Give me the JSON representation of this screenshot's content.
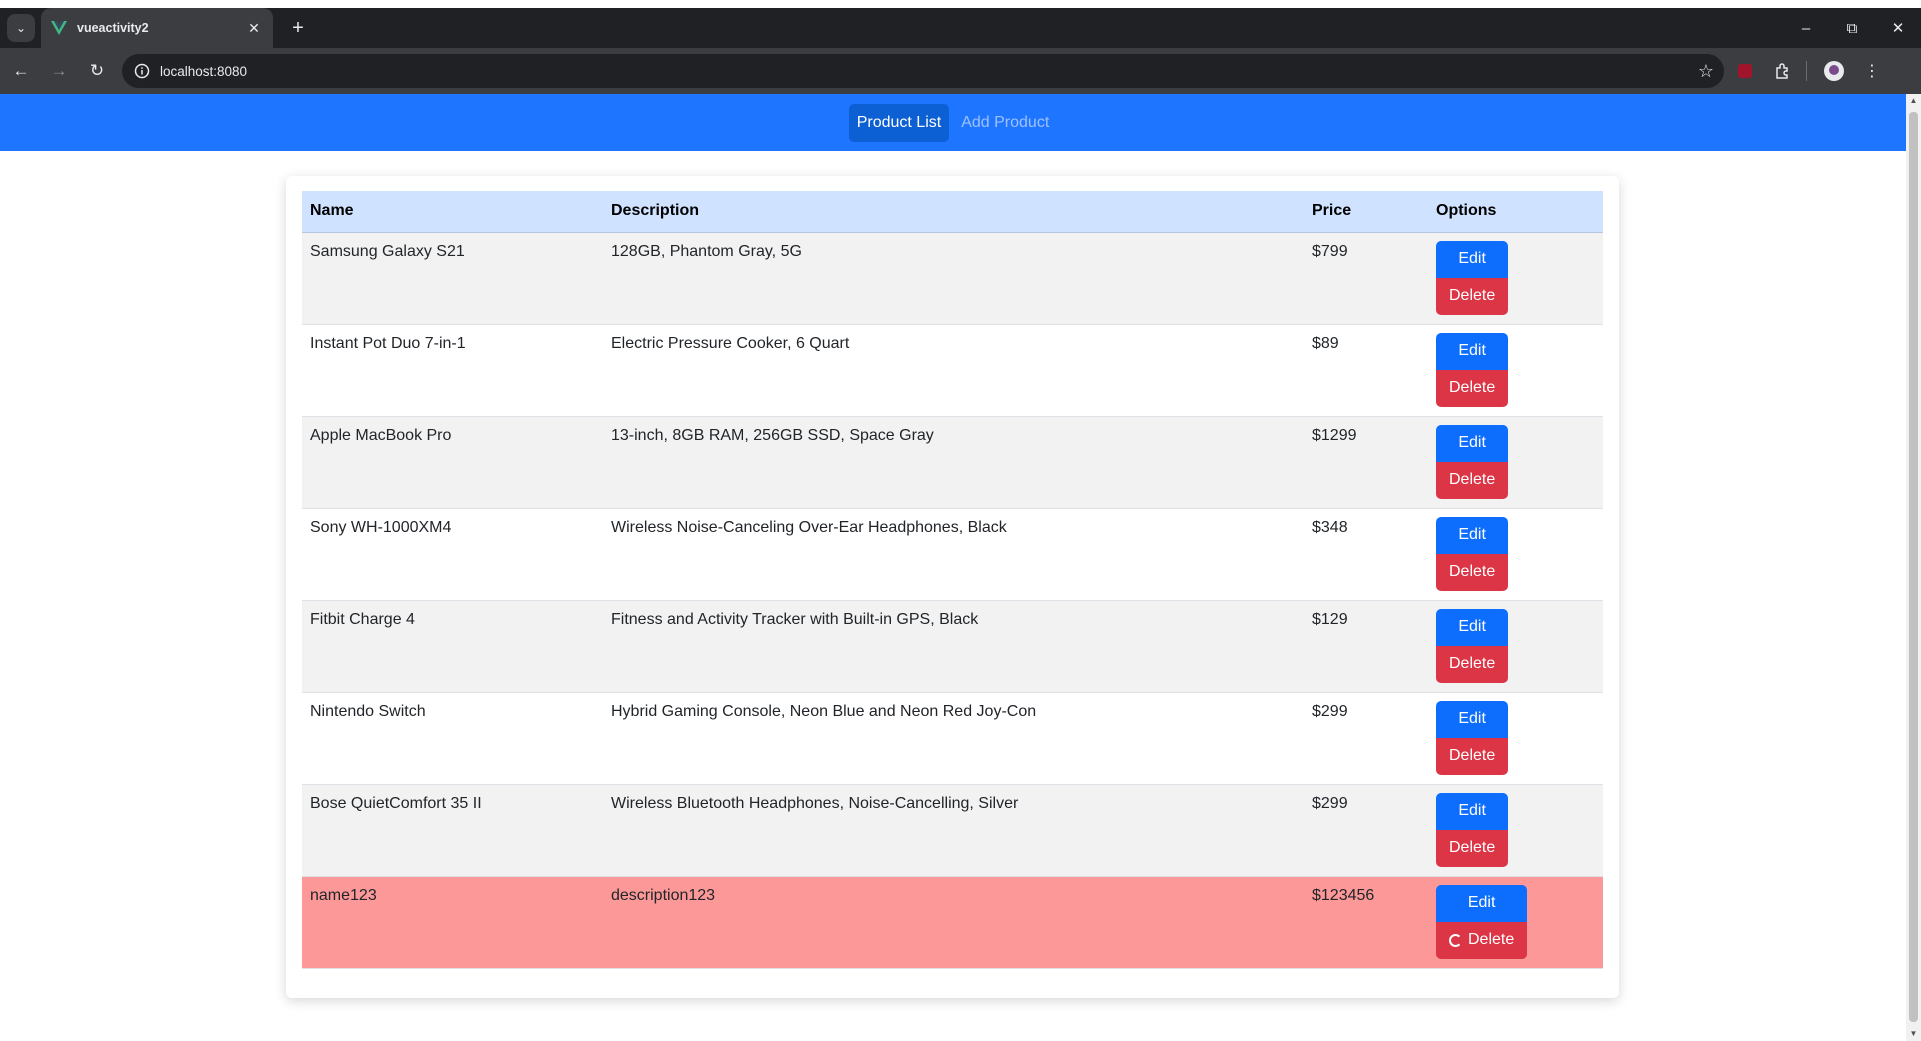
{
  "browser": {
    "tab_title": "vueactivity2",
    "url": "localhost:8080",
    "icons": [
      "tab-list-icon",
      "vue-logo-icon",
      "close-icon",
      "new-tab-icon",
      "minimize-icon",
      "restore-icon",
      "close-window-icon",
      "back-icon",
      "forward-icon",
      "reload-icon",
      "site-info-icon",
      "bookmark-star-icon",
      "ublock-extension-icon",
      "extensions-icon",
      "profile-avatar-icon",
      "menu-kebab-icon"
    ]
  },
  "navbar": {
    "links": [
      {
        "label": "Product List",
        "active": true
      },
      {
        "label": "Add Product",
        "active": false
      }
    ]
  },
  "table": {
    "headers": [
      "Name",
      "Description",
      "Price",
      "Options"
    ],
    "rows": [
      {
        "name": "Samsung Galaxy S21",
        "description": "128GB, Phantom Gray, 5G",
        "price": "$799",
        "edit": "Edit",
        "delete": "Delete"
      },
      {
        "name": "Instant Pot Duo 7-in-1",
        "description": "Electric Pressure Cooker, 6 Quart",
        "price": "$89",
        "edit": "Edit",
        "delete": "Delete"
      },
      {
        "name": "Apple MacBook Pro",
        "description": "13-inch, 8GB RAM, 256GB SSD, Space Gray",
        "price": "$1299",
        "edit": "Edit",
        "delete": "Delete"
      },
      {
        "name": "Sony WH-1000XM4",
        "description": "Wireless Noise-Canceling Over-Ear Headphones, Black",
        "price": "$348",
        "edit": "Edit",
        "delete": "Delete"
      },
      {
        "name": "Fitbit Charge 4",
        "description": "Fitness and Activity Tracker with Built-in GPS, Black",
        "price": "$129",
        "edit": "Edit",
        "delete": "Delete"
      },
      {
        "name": "Nintendo Switch",
        "description": "Hybrid Gaming Console, Neon Blue and Neon Red Joy-Con",
        "price": "$299",
        "edit": "Edit",
        "delete": "Delete"
      },
      {
        "name": "Bose QuietComfort 35 II",
        "description": "Wireless Bluetooth Headphones, Noise-Cancelling, Silver",
        "price": "$299",
        "edit": "Edit",
        "delete": "Delete"
      },
      {
        "name": "name123",
        "description": "description123",
        "price": "$123456",
        "edit": "Edit",
        "delete": "Delete",
        "deleting": true
      }
    ]
  },
  "colors": {
    "navbar": "#1e75ff",
    "header_row": "#cfe2ff",
    "edit_button": "#0d6efd",
    "delete_button": "#dc3545",
    "deleting_row": "#fd9898"
  }
}
